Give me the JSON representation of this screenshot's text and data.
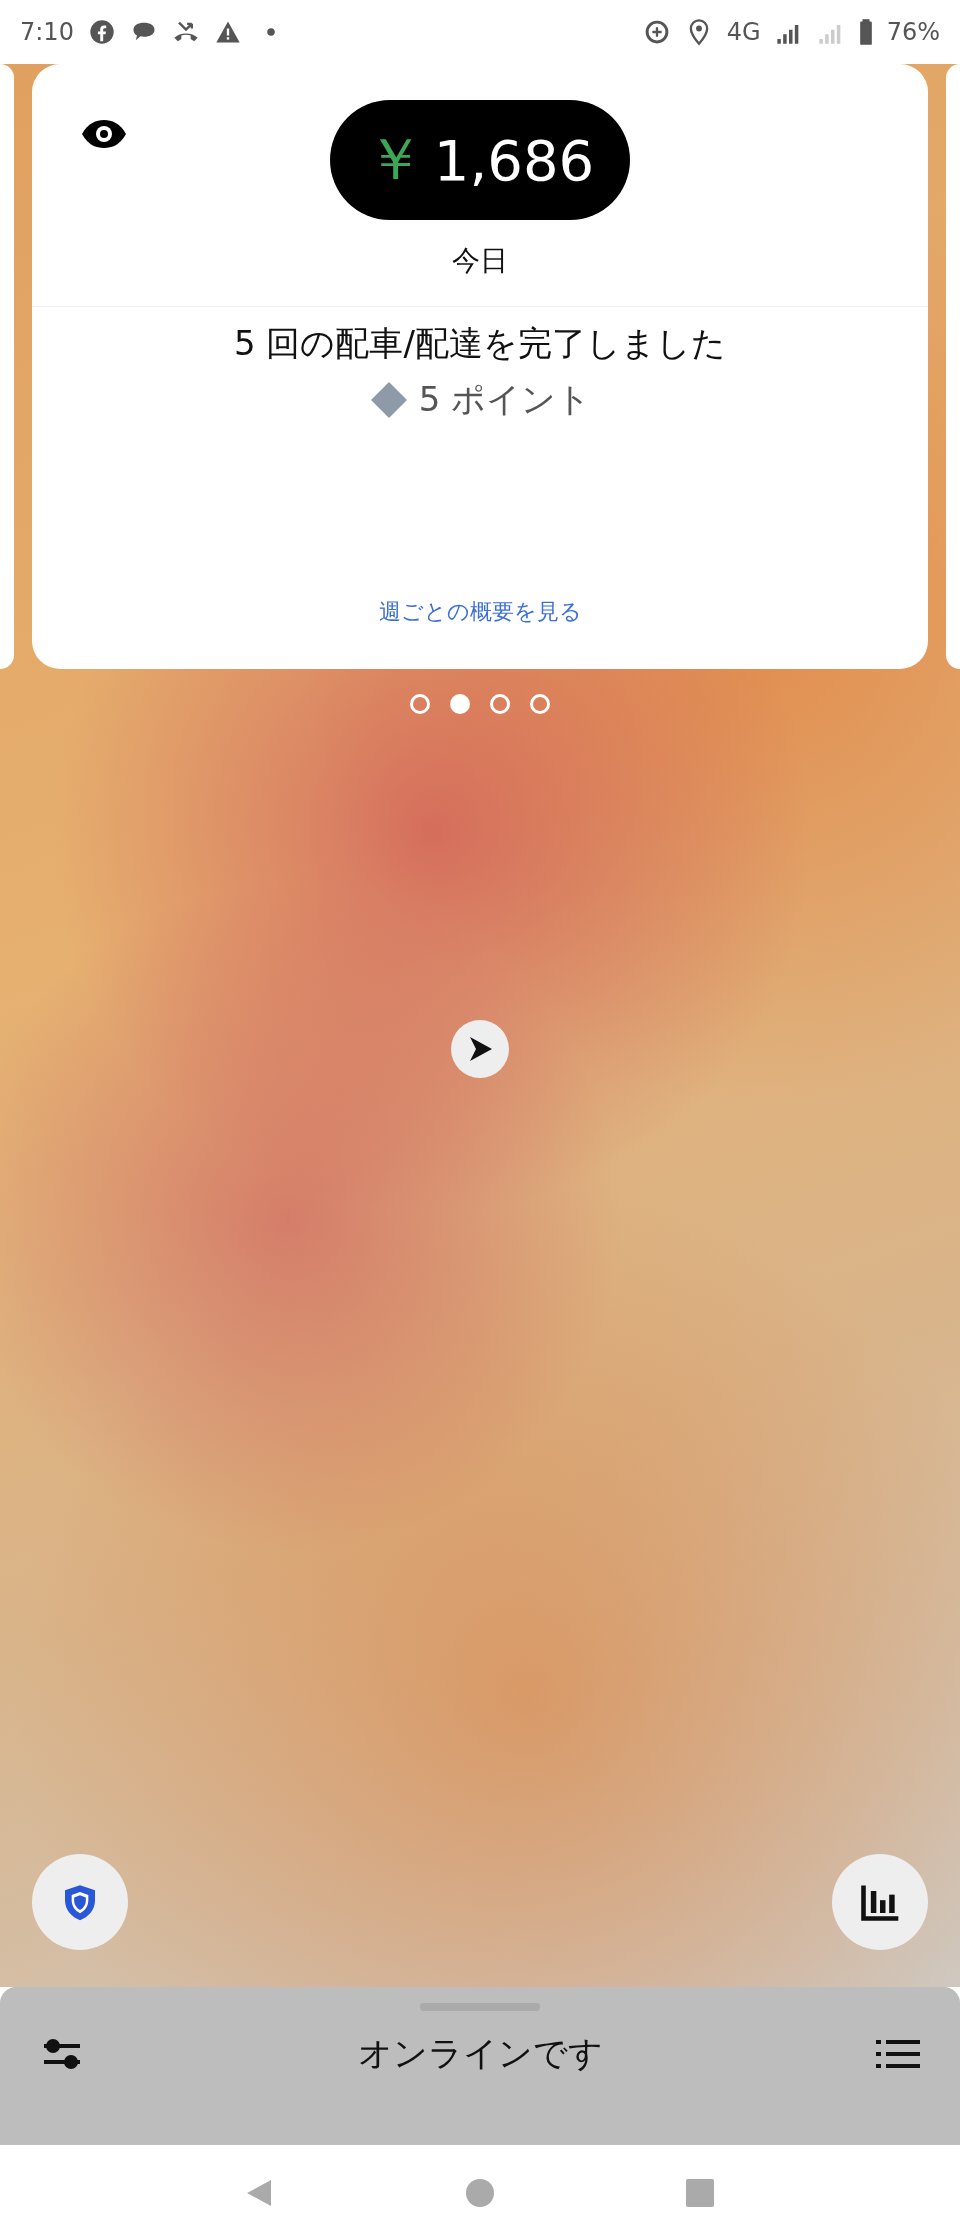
{
  "status_bar": {
    "time": "7:10",
    "network": "4G",
    "battery": "76%"
  },
  "earnings_card": {
    "currency": "￥",
    "amount": "1,686",
    "period": "今日",
    "summary": "5 回の配車/配達を完了しました",
    "points": "5 ポイント",
    "link": "週ごとの概要を見る"
  },
  "pager": [
    {
      "selected": false
    },
    {
      "selected": true
    },
    {
      "selected": false
    },
    {
      "selected": false
    }
  ],
  "bottom_sheet": {
    "status": "オンラインです"
  }
}
